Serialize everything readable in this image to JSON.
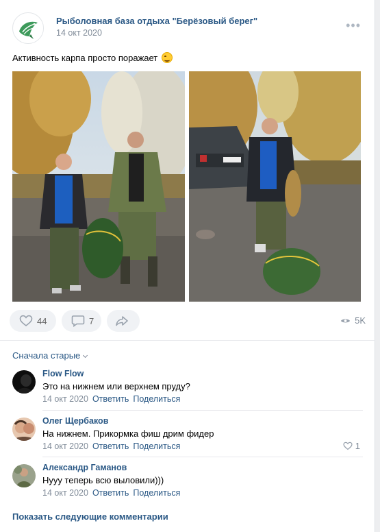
{
  "post": {
    "group_name": "Рыболовная база отдыха \"Берёзовый берег\"",
    "date": "14 окт 2020",
    "text": "Активность карпа просто поражает",
    "emoji_icon": "smiling-face-emoji",
    "more_icon": "more-dots-icon",
    "likes": "44",
    "comments": "7",
    "views": "5K"
  },
  "comments": {
    "sort_label": "Сначала старые",
    "reply_label": "Ответить",
    "share_label": "Поделиться",
    "items": [
      {
        "author": "Flow Flow",
        "text": "Это на нижнем или верхнем пруду?",
        "date": "14 окт 2020"
      },
      {
        "author": "Олег Щербаков",
        "text": "На нижнем. Прикормка фиш дрим фидер",
        "date": "14 окт 2020",
        "likes": "1"
      },
      {
        "author": "Александр Гаманов",
        "text": "Нууу теперь всю выловили)))",
        "date": "14 окт 2020"
      }
    ],
    "show_more_label": "Показать следующие комментарии"
  },
  "colors": {
    "link": "#2a5885",
    "secondary_text": "#818c99",
    "button_bg": "#f0f2f5"
  }
}
